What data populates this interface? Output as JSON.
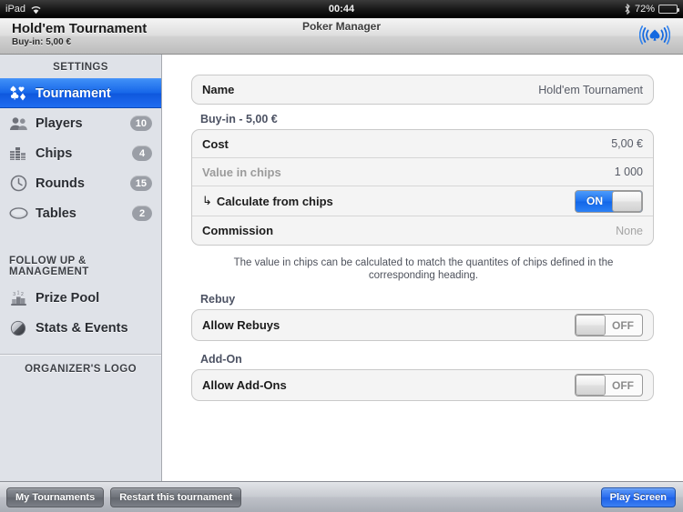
{
  "statusbar": {
    "carrier": "iPad",
    "wifi_icon": "wifi-icon",
    "time": "00:44",
    "bluetooth_icon": "bluetooth-icon",
    "battery_percent": "72%",
    "battery_icon": "battery-icon"
  },
  "navbar": {
    "app_title": "Poker Manager",
    "tournament_title": "Hold'em Tournament",
    "tournament_subtitle": "Buy-in: 5,00 €",
    "broadcast_icon": "broadcast-spade-icon"
  },
  "sidebar": {
    "settings_header": "SETTINGS",
    "management_header": "FOLLOW UP & MANAGEMENT",
    "logo_label": "ORGANIZER'S LOGO",
    "settings_items": [
      {
        "label": "Tournament",
        "icon": "card-suits-icon",
        "badge": "",
        "selected": true
      },
      {
        "label": "Players",
        "icon": "people-icon",
        "badge": "10",
        "selected": false
      },
      {
        "label": "Chips",
        "icon": "chip-stacks-icon",
        "badge": "4",
        "selected": false
      },
      {
        "label": "Rounds",
        "icon": "clock-icon",
        "badge": "15",
        "selected": false
      },
      {
        "label": "Tables",
        "icon": "poker-table-icon",
        "badge": "2",
        "selected": false
      }
    ],
    "management_items": [
      {
        "label": "Prize Pool",
        "icon": "podium-icon",
        "badge": "",
        "selected": false
      },
      {
        "label": "Stats & Events",
        "icon": "sphere-icon",
        "badge": "",
        "selected": false
      }
    ]
  },
  "main": {
    "name_row": {
      "label": "Name",
      "value": "Hold'em Tournament"
    },
    "buyin_group_title": "Buy-in - 5,00 €",
    "cost_row": {
      "label": "Cost",
      "value": "5,00 €"
    },
    "value_in_chips_row": {
      "label": "Value in chips",
      "value": "1 000"
    },
    "calculate_row": {
      "arrow": "↳",
      "label": "Calculate from chips",
      "toggle": "ON"
    },
    "commission_row": {
      "label": "Commission",
      "value": "None"
    },
    "footnote": "The value in chips can be calculated to match the quantites of chips defined in the corresponding heading.",
    "rebuy_group_title": "Rebuy",
    "rebuy_row": {
      "label": "Allow Rebuys",
      "toggle": "OFF"
    },
    "addon_group_title": "Add-On",
    "addon_row": {
      "label": "Allow Add-Ons",
      "toggle": "OFF"
    }
  },
  "toolbar": {
    "my_tournaments": "My Tournaments",
    "restart": "Restart this tournament",
    "play_screen": "Play Screen"
  }
}
